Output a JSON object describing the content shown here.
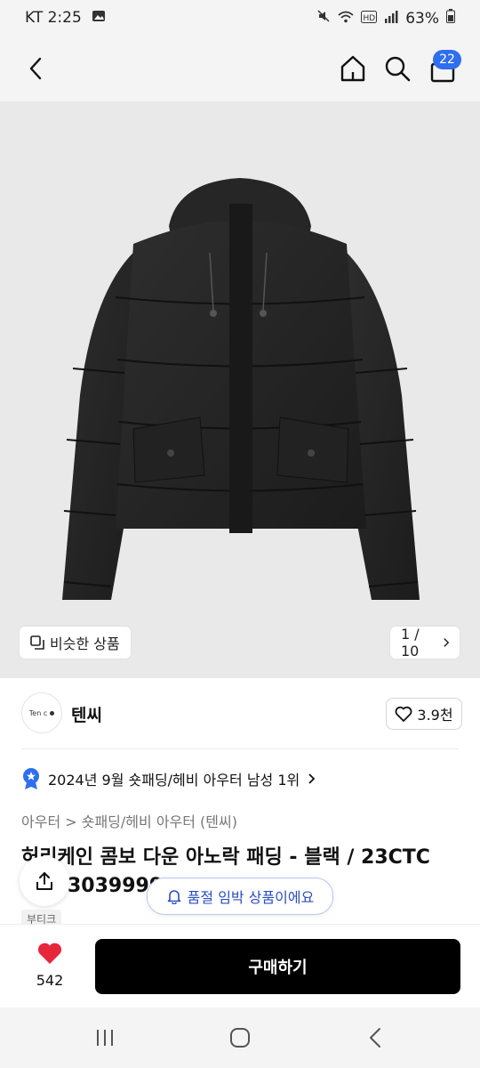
{
  "status_bar": {
    "carrier_time": "KT 2:25",
    "battery": "63%"
  },
  "header": {
    "cart_count": "22"
  },
  "hero": {
    "similar_label": "비슷한 상품",
    "page_indicator": "1 / 10"
  },
  "brand": {
    "logo_text": "Ten c",
    "name": "텐씨",
    "likes": "3.9천"
  },
  "ranking": {
    "text": "2024년 9월 숏패딩/헤비 아우터 남성 1위"
  },
  "category": {
    "path": "아우터 > 숏패딩/헤비 아우터 (텐씨)"
  },
  "product": {
    "title_line1": "허리케인 콤보 다운 아노락 패딩 - 블랙 / 23CTC",
    "title_line2": "3039999",
    "tag": "부티크"
  },
  "notice": {
    "soldout_text": "품절 임박 상품이에요"
  },
  "bottom": {
    "wish_count": "542",
    "buy_label": "구매하기"
  },
  "colors": {
    "accent_blue": "#2f6fed",
    "buy_button": "#000000",
    "heart": "#e8263a"
  }
}
